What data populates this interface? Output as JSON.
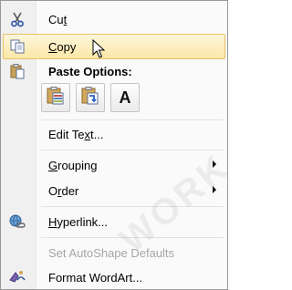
{
  "menu": {
    "items": [
      {
        "label": "Cut",
        "hot": "t",
        "pre": "Cu",
        "post": "",
        "icon": "scissors-icon"
      },
      {
        "label": "Copy",
        "hot": "C",
        "pre": "",
        "post": "opy",
        "icon": "copy-icon"
      },
      {
        "label": "Paste Options:",
        "icon": "paste-icon"
      },
      {
        "label": "Edit Text...",
        "hot": "x",
        "pre": "Edit Te",
        "post": "t..."
      },
      {
        "label": "Grouping",
        "hot": "G",
        "pre": "",
        "post": "rouping"
      },
      {
        "label": "Order",
        "hot": "r",
        "pre": "O",
        "post": "der"
      },
      {
        "label": "Hyperlink...",
        "hot": "H",
        "pre": "",
        "post": "yperlink...",
        "icon": "hyperlink-icon"
      },
      {
        "label": "Set AutoShape Defaults"
      },
      {
        "label": "Format WordArt...",
        "icon": "format-wordart-icon"
      }
    ],
    "paste_options": [
      {
        "name": "use-destination-theme",
        "icon": "paste-destination-theme-icon"
      },
      {
        "name": "keep-source-formatting",
        "icon": "paste-keep-source-icon"
      },
      {
        "name": "keep-text-only",
        "icon": "paste-text-only-icon",
        "glyph": "A"
      }
    ]
  },
  "watermark": "WORK"
}
